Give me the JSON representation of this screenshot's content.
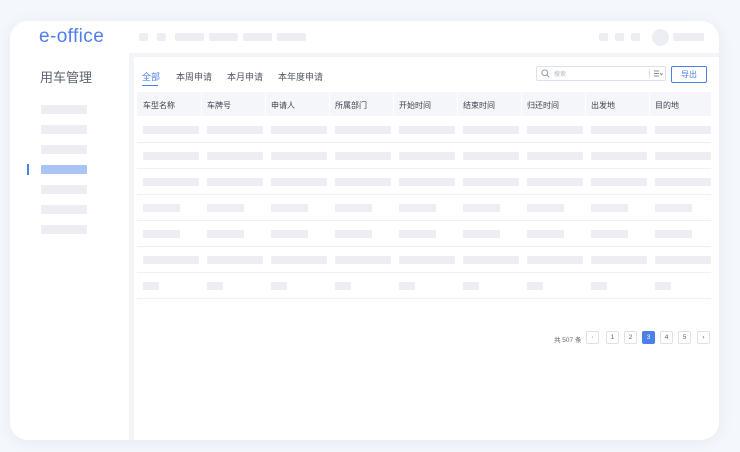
{
  "app": {
    "logo": "e-office"
  },
  "sidebar": {
    "title": "用车管理",
    "items": 7,
    "active_index": 3
  },
  "tabs": [
    {
      "label": "全部",
      "active": true
    },
    {
      "label": "本周申请",
      "active": false
    },
    {
      "label": "本月申请",
      "active": false
    },
    {
      "label": "本年度申请",
      "active": false
    }
  ],
  "search": {
    "placeholder": "搜索"
  },
  "toolbar": {
    "export_label": "导出"
  },
  "table": {
    "columns": [
      "车型名称",
      "车牌号",
      "申请人",
      "所属部门",
      "开始时间",
      "结束时间",
      "归还时间",
      "出发地",
      "目的地"
    ],
    "row_count": 7
  },
  "pagination": {
    "total_text": "共 507 条",
    "prev_icon": "‹",
    "next_icon": "›",
    "pages": [
      "1",
      "2",
      "3",
      "4",
      "5"
    ],
    "current": "3"
  },
  "colors": {
    "accent": "#4d7fe8",
    "placeholder": "#eceef3"
  }
}
